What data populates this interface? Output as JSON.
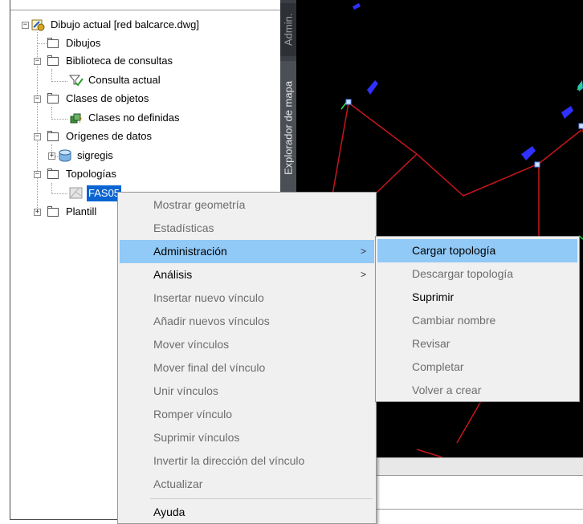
{
  "tree": {
    "root": "Dibujo actual [red balcarce.dwg]",
    "items": [
      {
        "label": "Dibujos"
      },
      {
        "label": "Biblioteca de consultas"
      },
      {
        "label": "Consulta actual"
      },
      {
        "label": "Clases de objetos"
      },
      {
        "label": "Clases no definidas"
      },
      {
        "label": "Orígenes de datos"
      },
      {
        "label": "sigregis"
      },
      {
        "label": "Topologías"
      },
      {
        "label": "FAS05"
      },
      {
        "label": "Plantill"
      }
    ]
  },
  "side_tabs": {
    "admin": "Admin.",
    "explorer": "Explorador de mapa"
  },
  "context_menu": {
    "items": [
      {
        "label": "Mostrar geometría",
        "enabled": false
      },
      {
        "label": "Estadísticas",
        "enabled": false
      },
      {
        "label": "Administración",
        "enabled": true,
        "highlighted": true,
        "submenu": true
      },
      {
        "label": "Análisis",
        "enabled": true,
        "submenu": true
      },
      {
        "label": "Insertar nuevo vínculo",
        "enabled": false
      },
      {
        "label": "Añadir nuevos vínculos",
        "enabled": false
      },
      {
        "label": "Mover vínculos",
        "enabled": false
      },
      {
        "label": "Mover final del vínculo",
        "enabled": false
      },
      {
        "label": "Unir vínculos",
        "enabled": false
      },
      {
        "label": "Romper vínculo",
        "enabled": false
      },
      {
        "label": "Suprimir vínculos",
        "enabled": false
      },
      {
        "label": "Invertir la dirección del vínculo",
        "enabled": false
      },
      {
        "label": "Actualizar",
        "enabled": false
      },
      {
        "label": "Ayuda",
        "enabled": true
      }
    ],
    "arrow": ">"
  },
  "submenu": {
    "items": [
      {
        "label": "Cargar topología",
        "enabled": true,
        "highlighted": true
      },
      {
        "label": "Descargar topología",
        "enabled": false
      },
      {
        "label": "Suprimir",
        "enabled": true
      },
      {
        "label": "Cambiar nombre",
        "enabled": false
      },
      {
        "label": "Revisar",
        "enabled": false
      },
      {
        "label": "Completar",
        "enabled": false
      },
      {
        "label": "Volver a crear",
        "enabled": false
      }
    ]
  },
  "colors": {
    "selection": "#0a64d2",
    "menu_highlight": "#91c9f7",
    "map_background": "#000000",
    "map_line": "#c8151b",
    "map_symbol": "#3030ff"
  }
}
